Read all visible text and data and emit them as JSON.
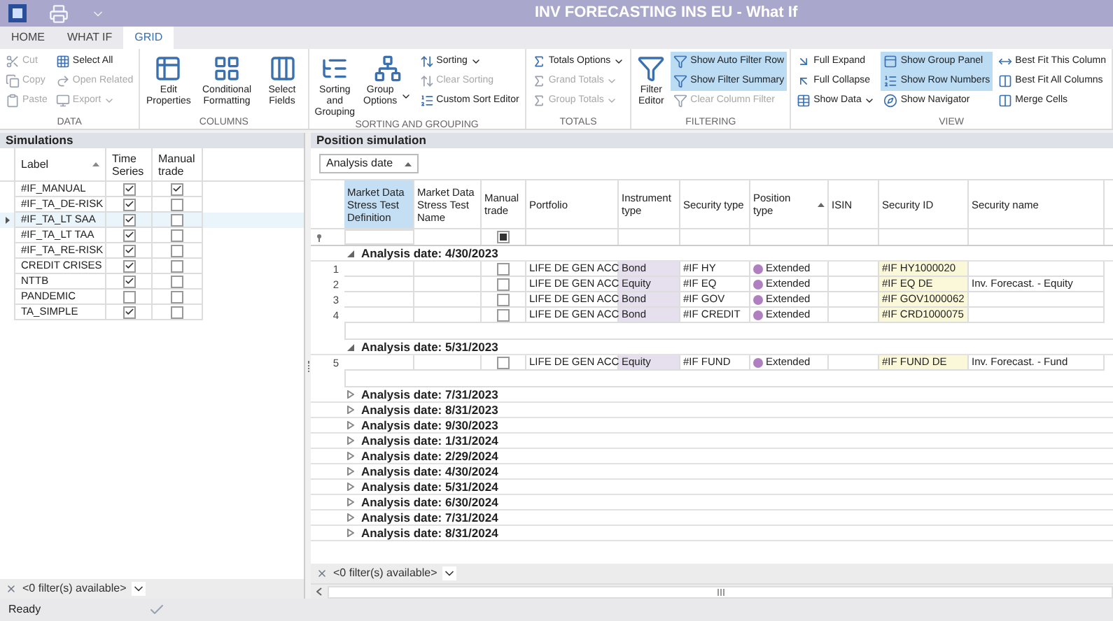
{
  "window": {
    "title": "INV FORECASTING INS EU - What If"
  },
  "tabs": [
    {
      "label": "HOME",
      "selected": false
    },
    {
      "label": "WHAT IF",
      "selected": false
    },
    {
      "label": "GRID",
      "selected": true
    }
  ],
  "ribbon": [
    {
      "label": "DATA",
      "columns": [
        {
          "kind": "stack",
          "items": [
            {
              "label": "Cut",
              "disabled": true,
              "selected": false
            },
            {
              "label": "Copy",
              "disabled": true,
              "selected": false
            },
            {
              "label": "Paste",
              "disabled": true,
              "selected": false
            }
          ]
        },
        {
          "kind": "stack",
          "items": [
            {
              "label": "Select All",
              "disabled": false,
              "selected": false
            },
            {
              "label": "Open Related",
              "disabled": true,
              "selected": false
            },
            {
              "label": "Export",
              "disabled": true,
              "selected": false,
              "dropdown": true
            }
          ]
        }
      ]
    },
    {
      "label": "COLUMNS",
      "columns": [
        {
          "kind": "large",
          "items": [
            {
              "label": "Edit Properties",
              "disabled": false,
              "selected": false
            },
            {
              "label": "Conditional Formatting",
              "disabled": false,
              "selected": false
            },
            {
              "label": "Select Fields",
              "disabled": false,
              "selected": false
            }
          ]
        }
      ]
    },
    {
      "label": "SORTING AND GROUPING",
      "columns": [
        {
          "kind": "large",
          "items": [
            {
              "label": "Sorting and Grouping",
              "disabled": false,
              "selected": false
            },
            {
              "label": "Group Options",
              "disabled": false,
              "selected": false,
              "dropdown": true
            }
          ]
        },
        {
          "kind": "stack",
          "items": [
            {
              "label": "Sorting",
              "disabled": false,
              "selected": false,
              "dropdown": true
            },
            {
              "label": "Clear Sorting",
              "disabled": true,
              "selected": false
            },
            {
              "label": "Custom Sort Editor",
              "disabled": false,
              "selected": false
            }
          ]
        }
      ]
    },
    {
      "label": "TOTALS",
      "columns": [
        {
          "kind": "stack",
          "items": [
            {
              "label": "Totals Options",
              "disabled": false,
              "selected": false,
              "dropdown": true
            },
            {
              "label": "Grand Totals",
              "disabled": true,
              "selected": false,
              "dropdown": true
            },
            {
              "label": "Group Totals",
              "disabled": true,
              "selected": false,
              "dropdown": true
            }
          ]
        }
      ]
    },
    {
      "label": "FILTERING",
      "columns": [
        {
          "kind": "large",
          "items": [
            {
              "label": "Filter Editor",
              "disabled": false,
              "selected": false
            }
          ]
        },
        {
          "kind": "stack",
          "items": [
            {
              "label": "Show Auto Filter Row",
              "disabled": false,
              "selected": true
            },
            {
              "label": "Show Filter Summary",
              "disabled": false,
              "selected": true
            },
            {
              "label": "Clear Column Filter",
              "disabled": true,
              "selected": false
            }
          ]
        }
      ]
    },
    {
      "label": "VIEW",
      "columns": [
        {
          "kind": "stack",
          "items": [
            {
              "label": "Full Expand",
              "disabled": false,
              "selected": false
            },
            {
              "label": "Full Collapse",
              "disabled": false,
              "selected": false
            },
            {
              "label": "Show Data",
              "disabled": false,
              "selected": false,
              "dropdown": true
            }
          ]
        },
        {
          "kind": "stack",
          "items": [
            {
              "label": "Show Group Panel",
              "disabled": false,
              "selected": true
            },
            {
              "label": "Show Row Numbers",
              "disabled": false,
              "selected": true
            },
            {
              "label": "Show Navigator",
              "disabled": false,
              "selected": false
            }
          ]
        },
        {
          "kind": "stack",
          "items": [
            {
              "label": "Best Fit This Column",
              "disabled": false,
              "selected": false
            },
            {
              "label": "Best Fit All Columns",
              "disabled": false,
              "selected": false
            },
            {
              "label": "Merge Cells",
              "disabled": false,
              "selected": false
            }
          ]
        }
      ]
    }
  ],
  "simulations": {
    "title": "Simulations",
    "columns": [
      "Label",
      "Time Series",
      "Manual trade"
    ],
    "rows": [
      {
        "label": "#IF_MANUAL",
        "time_series": true,
        "manual_trade": true,
        "selected": false
      },
      {
        "label": "#IF_TA_DE-RISK",
        "time_series": true,
        "manual_trade": false,
        "selected": false
      },
      {
        "label": "#IF_TA_LT SAA",
        "time_series": true,
        "manual_trade": false,
        "selected": true
      },
      {
        "label": "#IF_TA_LT TAA",
        "time_series": true,
        "manual_trade": false,
        "selected": false
      },
      {
        "label": "#IF_TA_RE-RISK",
        "time_series": true,
        "manual_trade": false,
        "selected": false
      },
      {
        "label": "CREDIT CRISES",
        "time_series": true,
        "manual_trade": false,
        "selected": false
      },
      {
        "label": "NTTB",
        "time_series": true,
        "manual_trade": false,
        "selected": false
      },
      {
        "label": "PANDEMIC",
        "time_series": false,
        "manual_trade": false,
        "selected": false
      },
      {
        "label": "TA_SIMPLE",
        "time_series": true,
        "manual_trade": false,
        "selected": false
      }
    ],
    "filter_text": "<0 filter(s) available>"
  },
  "positions": {
    "title": "Position simulation",
    "group_by": "Analysis date",
    "columns": [
      {
        "label": "Market Data Stress Test Definition",
        "selected": true
      },
      {
        "label": "Market Data Stress Test Name",
        "selected": false
      },
      {
        "label": "Manual trade",
        "selected": false
      },
      {
        "label": "Portfolio",
        "selected": false
      },
      {
        "label": "Instrument type",
        "selected": false
      },
      {
        "label": "Security type",
        "selected": false
      },
      {
        "label": "Position type",
        "selected": false
      },
      {
        "label": "ISIN",
        "selected": false
      },
      {
        "label": "Security ID",
        "selected": false
      },
      {
        "label": "Security name",
        "selected": false
      }
    ],
    "auto_filter_manual_trade": true,
    "groups": [
      {
        "label": "Analysis date: 4/30/2023",
        "expanded": true,
        "rows": [
          {
            "number": "1",
            "manual_trade": false,
            "portfolio": "LIFE DE GEN ACC",
            "instrument_type": "Bond",
            "security_type": "#IF HY",
            "position_type": "Extended",
            "security_id": "#IF HY1000020"
          },
          {
            "number": "2",
            "manual_trade": false,
            "portfolio": "LIFE DE GEN ACC",
            "instrument_type": "Equity",
            "security_type": "#IF EQ",
            "position_type": "Extended",
            "security_id": "#IF EQ DE",
            "security_name": "Inv. Forecast. - Equity"
          },
          {
            "number": "3",
            "manual_trade": false,
            "portfolio": "LIFE DE GEN ACC",
            "instrument_type": "Bond",
            "security_type": "#IF GOV",
            "position_type": "Extended",
            "security_id": "#IF GOV1000062"
          },
          {
            "number": "4",
            "manual_trade": false,
            "portfolio": "LIFE DE GEN ACC",
            "instrument_type": "Bond",
            "security_type": "#IF CREDIT",
            "position_type": "Extended",
            "security_id": "#IF CRD1000075"
          }
        ]
      },
      {
        "label": "Analysis date: 5/31/2023",
        "expanded": true,
        "rows": [
          {
            "number": "5",
            "manual_trade": false,
            "portfolio": "LIFE DE GEN ACC",
            "instrument_type": "Equity",
            "security_type": "#IF FUND",
            "position_type": "Extended",
            "security_id": "#IF FUND DE",
            "security_name": "Inv. Forecast. - Fund"
          }
        ]
      },
      {
        "label": "Analysis date: 7/31/2023",
        "expanded": false
      },
      {
        "label": "Analysis date: 8/31/2023",
        "expanded": false
      },
      {
        "label": "Analysis date: 9/30/2023",
        "expanded": false
      },
      {
        "label": "Analysis date: 1/31/2024",
        "expanded": false
      },
      {
        "label": "Analysis date: 2/29/2024",
        "expanded": false
      },
      {
        "label": "Analysis date: 4/30/2024",
        "expanded": false
      },
      {
        "label": "Analysis date: 5/31/2024",
        "expanded": false
      },
      {
        "label": "Analysis date: 6/30/2024",
        "expanded": false
      },
      {
        "label": "Analysis date: 7/31/2024",
        "expanded": false
      },
      {
        "label": "Analysis date: 8/31/2024",
        "expanded": false
      }
    ],
    "filter_text": "<0 filter(s) available>"
  },
  "status_bar": {
    "text": "Ready"
  }
}
